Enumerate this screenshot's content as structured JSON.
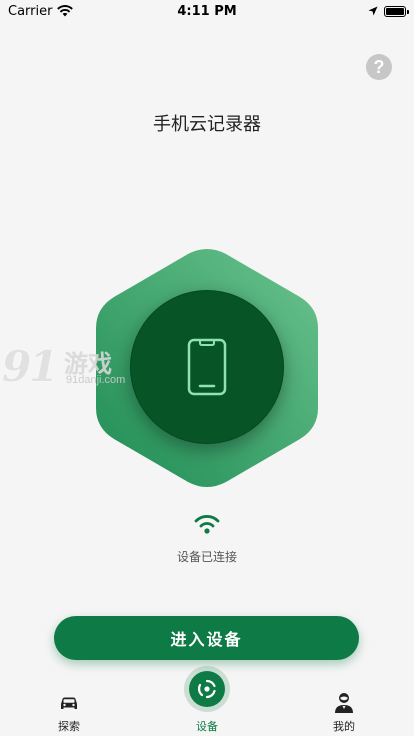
{
  "status_bar": {
    "carrier": "Carrier",
    "time": "4:11 PM"
  },
  "page": {
    "title": "手机云记录器"
  },
  "watermark": {
    "logo": "91",
    "text": "游戏",
    "url": "91danji.com"
  },
  "device": {
    "connection_status": "设备已连接",
    "icon": "phone-icon"
  },
  "actions": {
    "enter_label": "进入设备",
    "help_label": "?"
  },
  "tab_bar": {
    "tabs": [
      {
        "label": "探索",
        "icon": "car-icon"
      },
      {
        "label": "设备",
        "icon": "device-hub-icon"
      },
      {
        "label": "我的",
        "icon": "person-icon"
      }
    ]
  },
  "colors": {
    "primary": "#0e7a45",
    "hex_light": "#6bc38d",
    "hex_dark": "#1f8c55",
    "device_bg": "#075427",
    "background": "#f5f5f5"
  }
}
